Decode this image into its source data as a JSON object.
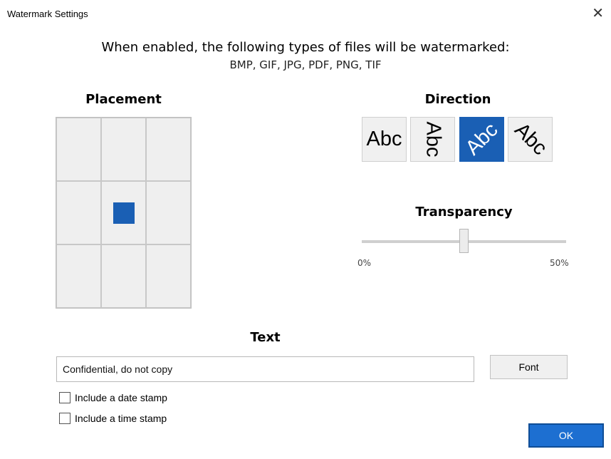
{
  "window": {
    "title": "Watermark Settings",
    "close_glyph": "✕"
  },
  "intro": {
    "line1": "When enabled, the following types of files will be watermarked:",
    "line2": "BMP, GIF, JPG, PDF, PNG, TIF"
  },
  "placement": {
    "title": "Placement",
    "selected_cell": "middle-center"
  },
  "direction": {
    "title": "Direction",
    "options": [
      {
        "label": "Abc",
        "orientation": "horizontal",
        "selected": false
      },
      {
        "label": "Abc",
        "orientation": "vertical",
        "selected": false
      },
      {
        "label": "Abc",
        "orientation": "diagonal-up",
        "selected": true
      },
      {
        "label": "Abc",
        "orientation": "diagonal-down",
        "selected": false
      }
    ]
  },
  "transparency": {
    "title": "Transparency",
    "min_label": "0%",
    "max_label": "50%",
    "value_fraction": 0.5
  },
  "text": {
    "title": "Text",
    "value": "Confidential, do not copy",
    "font_button": "Font",
    "date_stamp_label": "Include a date stamp",
    "date_stamp_checked": false,
    "time_stamp_label": "Include a time stamp",
    "time_stamp_checked": false
  },
  "ok_button": "OK",
  "colors": {
    "accent": "#1a5fb4",
    "ok_button": "#1d6fd1"
  }
}
